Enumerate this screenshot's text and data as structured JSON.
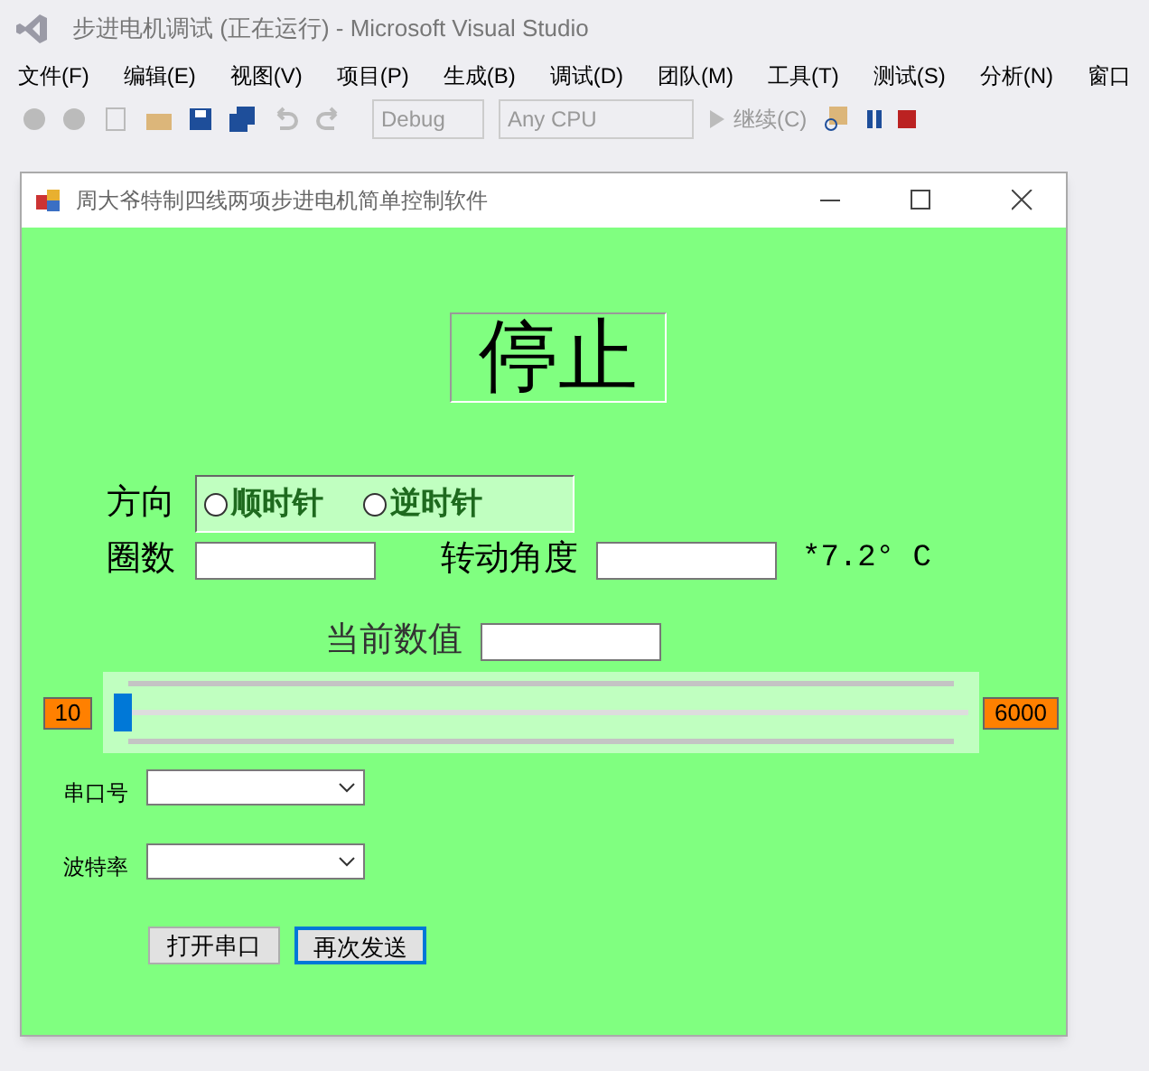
{
  "ide": {
    "title": "步进电机调试 (正在运行) - Microsoft Visual Studio",
    "menu": [
      "文件(F)",
      "编辑(E)",
      "视图(V)",
      "项目(P)",
      "生成(B)",
      "调试(D)",
      "团队(M)",
      "工具(T)",
      "测试(S)",
      "分析(N)",
      "窗口"
    ],
    "toolbar": {
      "configuration": "Debug",
      "platform": "Any CPU",
      "continue": "继续(C)"
    }
  },
  "window": {
    "title": "周大爷特制四线两项步进电机简单控制软件"
  },
  "status": "停止",
  "direction": {
    "label": "方向",
    "options": [
      {
        "label": "顺时针",
        "selected": false
      },
      {
        "label": "逆时针",
        "selected": false
      }
    ]
  },
  "turns": {
    "label": "圈数"
  },
  "angle": {
    "label": "转动角度",
    "unit": "*7.2° C"
  },
  "current": {
    "label": "当前数值"
  },
  "slider": {
    "min": "10",
    "max": "6000",
    "level": 0
  },
  "port": {
    "label": "串口号"
  },
  "baud": {
    "label": "波特率"
  },
  "buttons": [
    {
      "label": "打开串口",
      "focused": false
    },
    {
      "label": "再次发送",
      "focused": true
    }
  ]
}
